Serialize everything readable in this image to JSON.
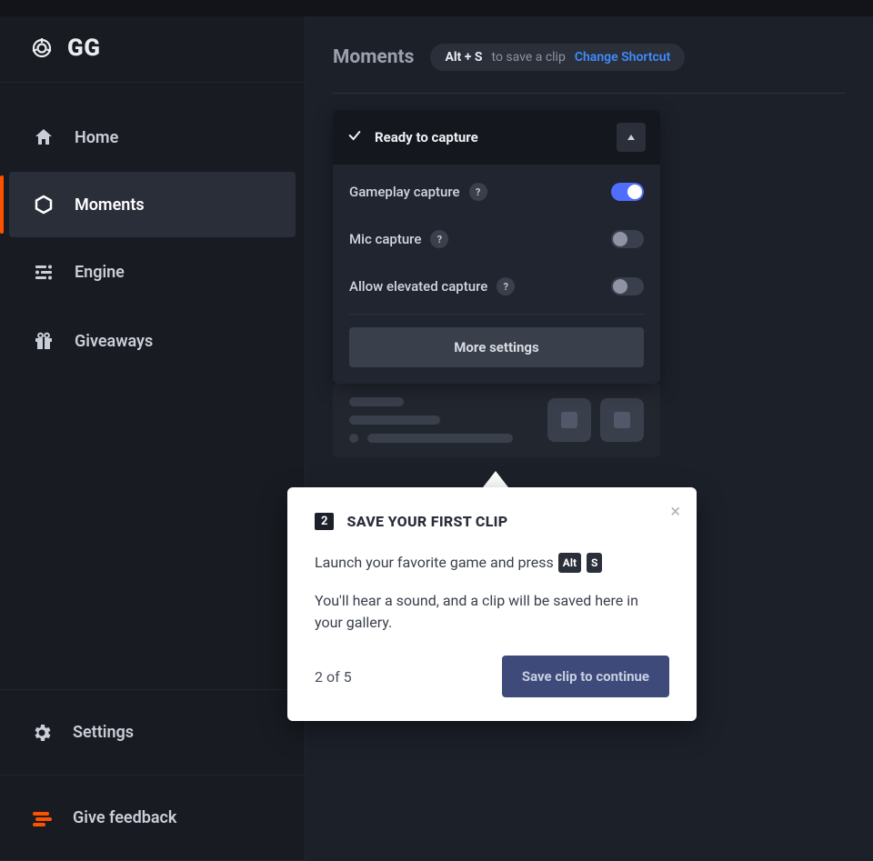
{
  "brand": {
    "name": "GG"
  },
  "sidebar": {
    "items": [
      {
        "label": "Home"
      },
      {
        "label": "Moments"
      },
      {
        "label": "Engine"
      },
      {
        "label": "Giveaways"
      }
    ],
    "bottom": [
      {
        "label": "Settings"
      },
      {
        "label": "Give feedback"
      }
    ]
  },
  "header": {
    "title": "Moments",
    "shortcut_key": "Alt + S",
    "shortcut_post": "to save a clip",
    "change_link": "Change Shortcut"
  },
  "capture": {
    "status": "Ready to capture",
    "rows": [
      {
        "label": "Gameplay capture",
        "on": true
      },
      {
        "label": "Mic capture",
        "on": false
      },
      {
        "label": "Allow elevated capture",
        "on": false
      }
    ],
    "more": "More settings"
  },
  "popup": {
    "step_num": "2",
    "title": "SAVE YOUR FIRST CLIP",
    "line1_pre": "Launch your favorite game and press ",
    "key1": "Alt",
    "key2": "S",
    "line2": "You'll hear a sound, and a clip will be saved here in your gallery.",
    "progress": "2 of 5",
    "button": "Save clip to continue"
  }
}
